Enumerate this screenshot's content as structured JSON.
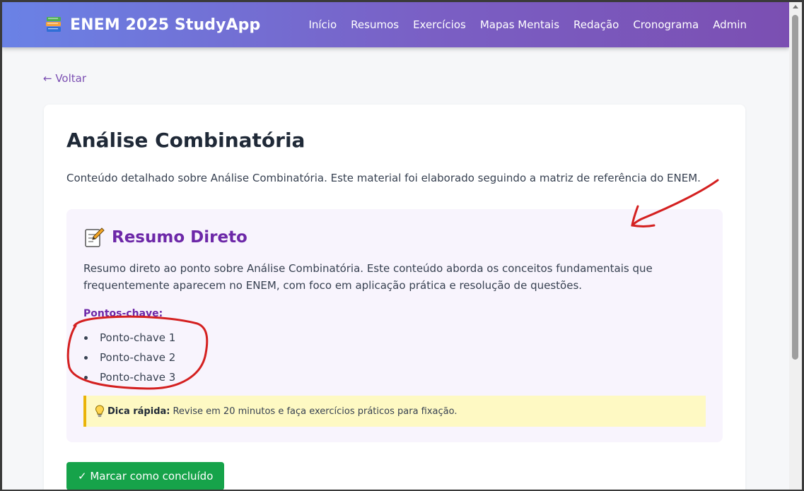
{
  "header": {
    "title": "ENEM 2025 StudyApp",
    "logo_icon": "books-icon",
    "nav": [
      "Início",
      "Resumos",
      "Exercícios",
      "Mapas Mentais",
      "Redação",
      "Cronograma",
      "Admin"
    ]
  },
  "back_link": "← Voltar",
  "content": {
    "title": "Análise Combinatória",
    "intro": "Conteúdo detalhado sobre Análise Combinatória. Este material foi elaborado seguindo a matriz de referência do ENEM.",
    "summary": {
      "icon": "memo-icon",
      "title": "Resumo Direto",
      "text": "Resumo direto ao ponto sobre Análise Combinatória. Este conteúdo aborda os conceitos fundamentais que frequentemente aparecem no ENEM, com foco em aplicação prática e resolução de questões.",
      "key_points_label": "Pontos-chave:",
      "key_points": [
        "Ponto-chave 1",
        "Ponto-chave 2",
        "Ponto-chave 3"
      ],
      "tip": {
        "icon": "lightbulb-icon",
        "label": "Dica rápida:",
        "text": "Revise em 20 minutos e faça exercícios práticos para fixação."
      }
    },
    "complete_button": "✓ Marcar como concluído"
  },
  "colors": {
    "accent": "#6d28a8",
    "success": "#16a34a",
    "annotation": "#d42020"
  }
}
